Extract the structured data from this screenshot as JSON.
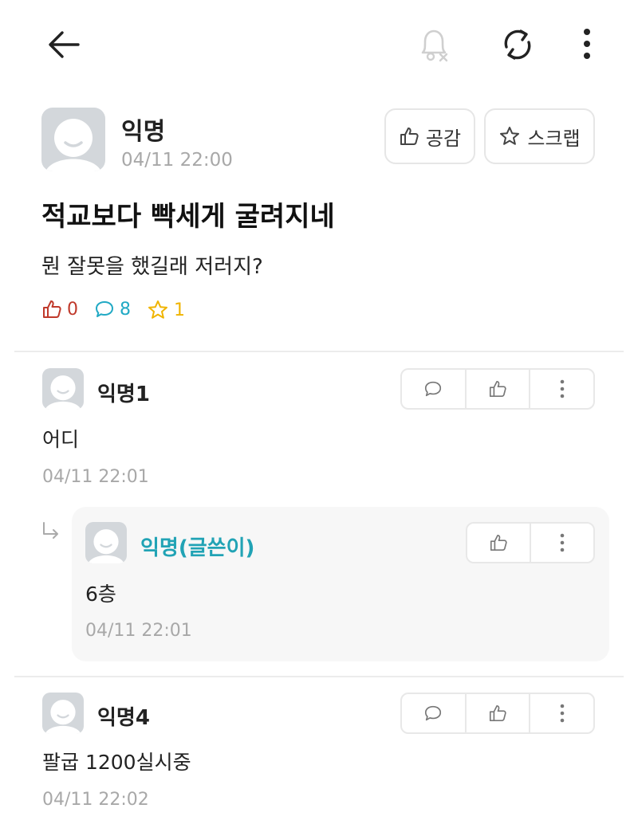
{
  "header": {
    "back_icon": "arrow-left-icon",
    "bell_icon": "notification-off-icon",
    "refresh_icon": "refresh-icon",
    "more_icon": "more-vertical-icon"
  },
  "post": {
    "author": "익명",
    "timestamp": "04/11 22:00",
    "like_label": "공감",
    "scrap_label": "스크랩",
    "title": "적교보다 빡세게 굴려지네",
    "body": "뭔 잘못을 했길래 저러지?",
    "stats": {
      "likes": "0",
      "comments": "8",
      "scraps": "1"
    }
  },
  "comments": [
    {
      "author": "익명1",
      "body": "어디",
      "timestamp": "04/11 22:01"
    },
    {
      "author": "익명4",
      "body": "팔굽 1200실시중",
      "timestamp": "04/11 22:02"
    }
  ],
  "reply": {
    "author": "익명(글쓴이)",
    "body": "6층",
    "timestamp": "04/11 22:01"
  },
  "colors": {
    "like_red": "#c0392b",
    "comment_teal": "#21a9c4",
    "scrap_yellow": "#f0b400",
    "writer_teal": "#21a3b5",
    "muted_gray": "#a8a8a8"
  }
}
